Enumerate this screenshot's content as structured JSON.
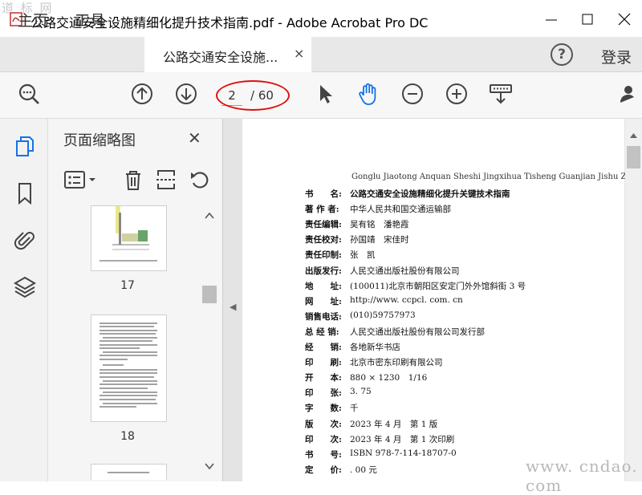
{
  "window": {
    "title": "公路交通安全设施精细化提升技术指南.pdf - Adobe Acrobat Pro DC",
    "watermark_top": "道 标 网"
  },
  "nav": {
    "home": "主页",
    "tools": "工具",
    "signin": "登录",
    "help": "?"
  },
  "tab": {
    "label": "公路交通安全设施...",
    "close": "×"
  },
  "toolbar": {
    "current_page": "2",
    "total_pages": "/ 60"
  },
  "panel": {
    "title": "页面缩略图",
    "close": "✕",
    "thumbnails": [
      {
        "number": "17"
      },
      {
        "number": "18"
      }
    ]
  },
  "document": {
    "pinyin_title": "Gonglu Jiaotong Anquan Sheshi Jingxihua Tisheng Guanjian Jishu Zhinan",
    "rows": [
      {
        "k": "书　　名:",
        "v": "公路交通安全设施精细化提升关键技术指南",
        "bold": true
      },
      {
        "k": "著 作 者:",
        "v": "中华人民共和国交通运输部"
      },
      {
        "k": "责任编辑:",
        "v": "吴有铭　潘艳霞"
      },
      {
        "k": "责任校对:",
        "v": "孙国靖　宋佳时"
      },
      {
        "k": "责任印制:",
        "v": "张　凯"
      },
      {
        "k": "出版发行:",
        "v": "人民交通出版社股份有限公司"
      },
      {
        "k": "地　　址:",
        "v": "(100011)北京市朝阳区安定门外外馆斜街 3 号"
      },
      {
        "k": "网　　址:",
        "v": "http://www. ccpcl. com. cn"
      },
      {
        "k": "销售电话:",
        "v": "(010)59757973"
      },
      {
        "k": "总 经 销:",
        "v": "人民交通出版社股份有限公司发行部"
      },
      {
        "k": "经　　销:",
        "v": "各地新华书店"
      },
      {
        "k": "印　　刷:",
        "v": "北京市密东印刷有限公司"
      },
      {
        "k": "开　　本:",
        "v": "880 × 1230　1/16"
      },
      {
        "k": "印　　张:",
        "v": "3. 75"
      },
      {
        "k": "字　　数:",
        "v": "千"
      },
      {
        "k": "版　　次:",
        "v": "2023 年 4 月　第 1 版"
      },
      {
        "k": "印　　次:",
        "v": "2023 年 4 月　第 1 次印刷"
      },
      {
        "k": "书　　号:",
        "v": "ISBN 978-7-114-18707-0"
      },
      {
        "k": "定　　价:",
        "v": ". 00 元"
      }
    ],
    "watermark_bottom": "www. cndao. com"
  },
  "colors": {
    "highlight_circle": "#e01010",
    "hand_tool": "#1473e6",
    "accent": "#1473e6"
  }
}
